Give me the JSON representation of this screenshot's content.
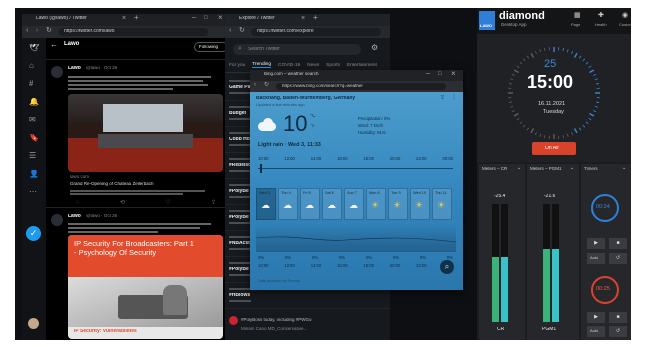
{
  "colors": {
    "background": "#0d0f13",
    "twitter_blue": "#1d9bf0",
    "diamond_blue": "#2f7fd8",
    "clock_active": "#3a86d8",
    "on_air_red": "#d9432c",
    "meter_green": "#39b37a",
    "meter_cyan": "#39c2c8",
    "timer_red": "#d9432c",
    "weather_sky": "#3a8fc4"
  },
  "twitter": {
    "tab_title": "Lawo (@lawo) / Twitter",
    "url": "https://twitter.com/lawo",
    "profile_name": "Lawo",
    "follow_label": "Following",
    "rail_icons": [
      "twitter-icon",
      "home-icon",
      "explore-icon",
      "notifications-icon",
      "messages-icon",
      "bookmarks-icon",
      "lists-icon",
      "profile-icon",
      "more-icon"
    ],
    "tweet_action": "compose-icon",
    "tweets": [
      {
        "author": "Lawo",
        "handle": "@lawo · Oct 28",
        "link_domain": "lawo.com",
        "link_title": "Grand Re-Opening of Chateau Zellerbach"
      },
      {
        "author": "Lawo",
        "handle": "@lawo · Oct 26",
        "card_title": "IP Security For Broadcasters: Part 1 - Psychology Of Security",
        "card_caption": "IP Security: Vulnerabilities"
      }
    ]
  },
  "explore": {
    "tab_title": "Explore / Twitter",
    "url": "https://twitter.com/explore",
    "search_placeholder": "Search Twitter",
    "tabs": [
      "For you",
      "Trending",
      "COVID-19",
      "News",
      "Sports",
      "Entertainment"
    ],
    "active_tab": 1,
    "trend_items": [
      "Game Pass",
      "Budget",
      "Cobb Hone",
      "#Rebelsc",
      "#PolyBe",
      "#PolyBe",
      "#NBAcst",
      "#PolyBe",
      "#HBlows"
    ],
    "footer_item": "#PolyBoss today, including #PWGo",
    "footer_note": "Miriam Cano MD_Conservative..."
  },
  "weather": {
    "tab_title": "Bing.com – weather search",
    "url": "https://www.bing.com/search?q=weather",
    "location": "Backnang, Baden-Württemberg, Germany",
    "updated": "Updated a few minutes ago",
    "temperature": "10",
    "unit_c": "°C",
    "unit_f": "°F",
    "details": [
      "Precipitation: 0%",
      "Wind: 7 km/h",
      "Humidity: 91%"
    ],
    "condition": "Light rain · Wed 3, 11:33",
    "hours": [
      "10:00",
      "12:00",
      "14:00",
      "16:00",
      "18:00",
      "20:00",
      "22:00",
      "00:00"
    ],
    "days": [
      {
        "day": "Wed 3",
        "icon": "cloud-icon"
      },
      {
        "day": "Thu 4",
        "icon": "cloud-icon"
      },
      {
        "day": "Fri 5",
        "icon": "cloud-icon"
      },
      {
        "day": "Sat 6",
        "icon": "cloud-icon"
      },
      {
        "day": "Sun 7",
        "icon": "cloud-icon"
      },
      {
        "day": "Mon 8",
        "icon": "sun-icon"
      },
      {
        "day": "Tue 9",
        "icon": "sun-icon"
      },
      {
        "day": "Wed 10",
        "icon": "sun-icon"
      },
      {
        "day": "Thu 11",
        "icon": "sun-icon"
      }
    ],
    "percents": [
      "0%",
      "0%",
      "0%",
      "0%",
      "0%",
      "0%",
      "0%",
      "0%"
    ],
    "footer_note": "Data provided by Foreca"
  },
  "diamond": {
    "brand": "diamond",
    "subtitle": "Desktop App",
    "logo": "LAWO",
    "nav": [
      {
        "label": "Page",
        "icon": "page-icon"
      },
      {
        "label": "Health",
        "icon": "health-icon"
      },
      {
        "label": "Custom",
        "icon": "custom-icon"
      }
    ],
    "clock_seconds": "25",
    "clock_time": "15:00",
    "clock_date": "16.11.2021",
    "clock_day": "Tuesday",
    "on_air_label": "On Air",
    "meters": [
      {
        "title": "Meters – CR",
        "value": "-25.4",
        "label": "CR",
        "level": 0.55
      },
      {
        "title": "Meters – PGM1",
        "value": "-21.6",
        "label": "PGM1",
        "level": 0.62
      }
    ],
    "timers_title": "Timers",
    "timer_1": "00:24",
    "timer_2": "00:25",
    "button_labels": [
      "Auto",
      "Reset"
    ]
  }
}
